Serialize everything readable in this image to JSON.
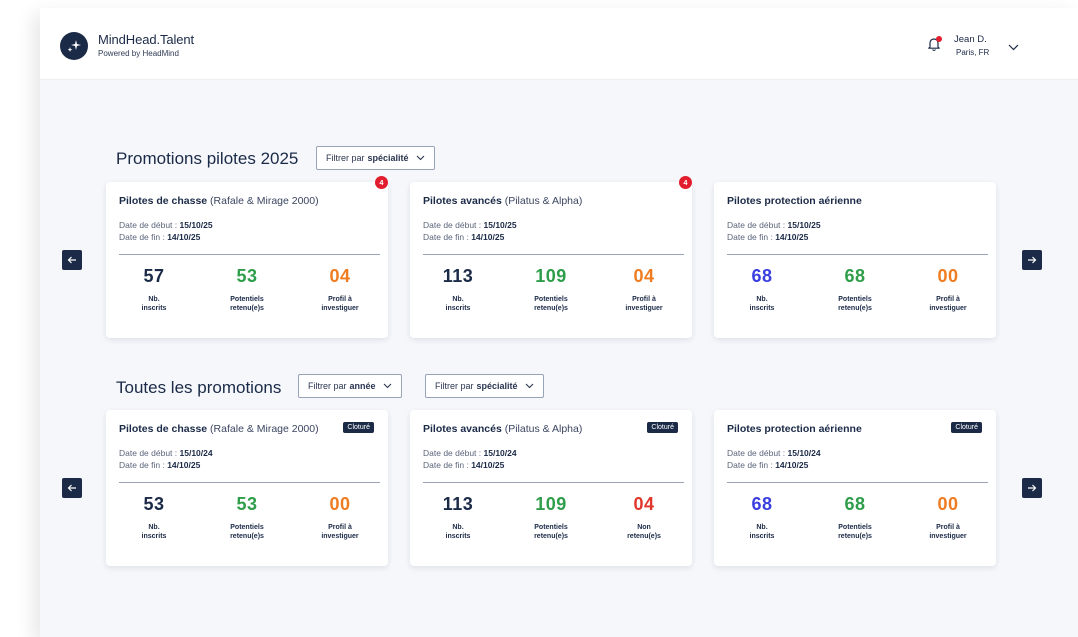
{
  "header": {
    "brand_name": "MindHead.Talent",
    "brand_sub": "Powered by HeadMind",
    "user_name": "Jean D.",
    "user_city": "Paris, FR"
  },
  "colors": {
    "navy": "#1b2a47",
    "blue": "#3b3fe0",
    "green": "#2f9e4a",
    "orange": "#f07c22",
    "red": "#e0362b"
  },
  "pilots_section": {
    "title": "Promotions pilotes 2025",
    "filter_prefix": "Filtrer par",
    "filter_key": "spécialité",
    "cards": [
      {
        "title_bold": "Pilotes de chasse",
        "title_rest": " (Rafale & Mirage 2000)",
        "badge": "4",
        "start_label": "Date de début : ",
        "start_date": "15/10/25",
        "end_label": "Date de fin : ",
        "end_date": "14/10/25",
        "stats": [
          {
            "value": "57",
            "label1": "Nb.",
            "label2": "inscrits",
            "color": "navy"
          },
          {
            "value": "53",
            "label1": "Potentiels",
            "label2": "retenu(e)s",
            "color": "green"
          },
          {
            "value": "04",
            "label1": "Profil à",
            "label2": "investiguer",
            "color": "orange"
          }
        ]
      },
      {
        "title_bold": "Pilotes avancés",
        "title_rest": " (Pilatus & Alpha)",
        "badge": "4",
        "start_label": "Date de début : ",
        "start_date": "15/10/25",
        "end_label": "Date de fin : ",
        "end_date": "14/10/25",
        "stats": [
          {
            "value": "113",
            "label1": "Nb.",
            "label2": "inscrits",
            "color": "navy"
          },
          {
            "value": "109",
            "label1": "Potentiels",
            "label2": "retenu(e)s",
            "color": "green"
          },
          {
            "value": "04",
            "label1": "Profil à",
            "label2": "investiguer",
            "color": "orange"
          }
        ]
      },
      {
        "title_bold": "Pilotes protection aérienne",
        "title_rest": "",
        "badge": "",
        "start_label": "Date de début : ",
        "start_date": "15/10/25",
        "end_label": "Date de fin : ",
        "end_date": "14/10/25",
        "stats": [
          {
            "value": "68",
            "label1": "Nb.",
            "label2": "inscrits",
            "color": "blue"
          },
          {
            "value": "68",
            "label1": "Potentiels",
            "label2": "retenu(e)s",
            "color": "green"
          },
          {
            "value": "00",
            "label1": "Profil à",
            "label2": "investiguer",
            "color": "orange"
          }
        ]
      }
    ]
  },
  "all_section": {
    "title": "Toutes les promotions",
    "filter_year_prefix": "Filtrer par",
    "filter_year_key": "année",
    "filter_spec_prefix": "Filtrer par",
    "filter_spec_key": "spécialité",
    "closed_label": "Cloturé",
    "cards": [
      {
        "title_bold": "Pilotes de chasse",
        "title_rest": " (Rafale & Mirage 2000)",
        "start_label": "Date de début : ",
        "start_date": "15/10/24",
        "end_label": "Date de fin : ",
        "end_date": "14/10/25",
        "stats": [
          {
            "value": "53",
            "label1": "Nb.",
            "label2": "inscrits",
            "color": "navy"
          },
          {
            "value": "53",
            "label1": "Potentiels",
            "label2": "retenu(e)s",
            "color": "green"
          },
          {
            "value": "00",
            "label1": "Profil à",
            "label2": "investiguer",
            "color": "orange"
          }
        ]
      },
      {
        "title_bold": "Pilotes avancés",
        "title_rest": " (Pilatus & Alpha)",
        "start_label": "Date de début : ",
        "start_date": "15/10/24",
        "end_label": "Date de fin : ",
        "end_date": "14/10/25",
        "stats": [
          {
            "value": "113",
            "label1": "Nb.",
            "label2": "inscrits",
            "color": "navy"
          },
          {
            "value": "109",
            "label1": "Potentiels",
            "label2": "retenu(e)s",
            "color": "green"
          },
          {
            "value": "04",
            "label1": "Non",
            "label2": "retenu(e)s",
            "color": "red"
          }
        ]
      },
      {
        "title_bold": "Pilotes protection aérienne",
        "title_rest": "",
        "start_label": "Date de début : ",
        "start_date": "15/10/24",
        "end_label": "Date de fin : ",
        "end_date": "14/10/25",
        "stats": [
          {
            "value": "68",
            "label1": "Nb.",
            "label2": "inscrits",
            "color": "blue"
          },
          {
            "value": "68",
            "label1": "Potentiels",
            "label2": "retenu(e)s",
            "color": "green"
          },
          {
            "value": "00",
            "label1": "Profil à",
            "label2": "investiguer",
            "color": "orange"
          }
        ]
      }
    ]
  }
}
